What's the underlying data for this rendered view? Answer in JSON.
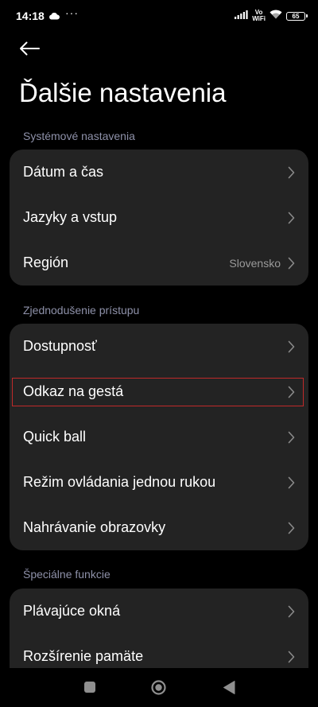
{
  "status_bar": {
    "time": "14:18",
    "more_indicator": "···",
    "volte_line1": "Vo",
    "volte_line2": "WiFi",
    "battery": "65"
  },
  "header": {
    "back_icon": "arrow-left-icon",
    "title": "Ďalšie nastavenia"
  },
  "sections": [
    {
      "title": "Systémové nastavenia",
      "items": [
        {
          "label": "Dátum a čas",
          "value": ""
        },
        {
          "label": "Jazyky a vstup",
          "value": ""
        },
        {
          "label": "Región",
          "value": "Slovensko"
        }
      ]
    },
    {
      "title": "Zjednodušenie prístupu",
      "items": [
        {
          "label": "Dostupnosť",
          "value": ""
        },
        {
          "label": "Odkaz na gestá",
          "value": "",
          "highlighted": true
        },
        {
          "label": "Quick ball",
          "value": ""
        },
        {
          "label": "Režim ovládania jednou rukou",
          "value": ""
        },
        {
          "label": "Nahrávanie obrazovky",
          "value": ""
        }
      ]
    },
    {
      "title": "Špeciálne funkcie",
      "items": [
        {
          "label": "Plávajúce okná",
          "value": ""
        },
        {
          "label": "Rozšírenie pamäte",
          "value": ""
        }
      ]
    }
  ],
  "nav_bar": {
    "recents_icon": "square-icon",
    "home_icon": "circle-icon",
    "back_icon": "triangle-back-icon"
  },
  "colors": {
    "background": "#000000",
    "card": "#232323",
    "section_header": "#8e91a9",
    "secondary_text": "#9a9a9a",
    "highlight": "#c02a2a"
  }
}
